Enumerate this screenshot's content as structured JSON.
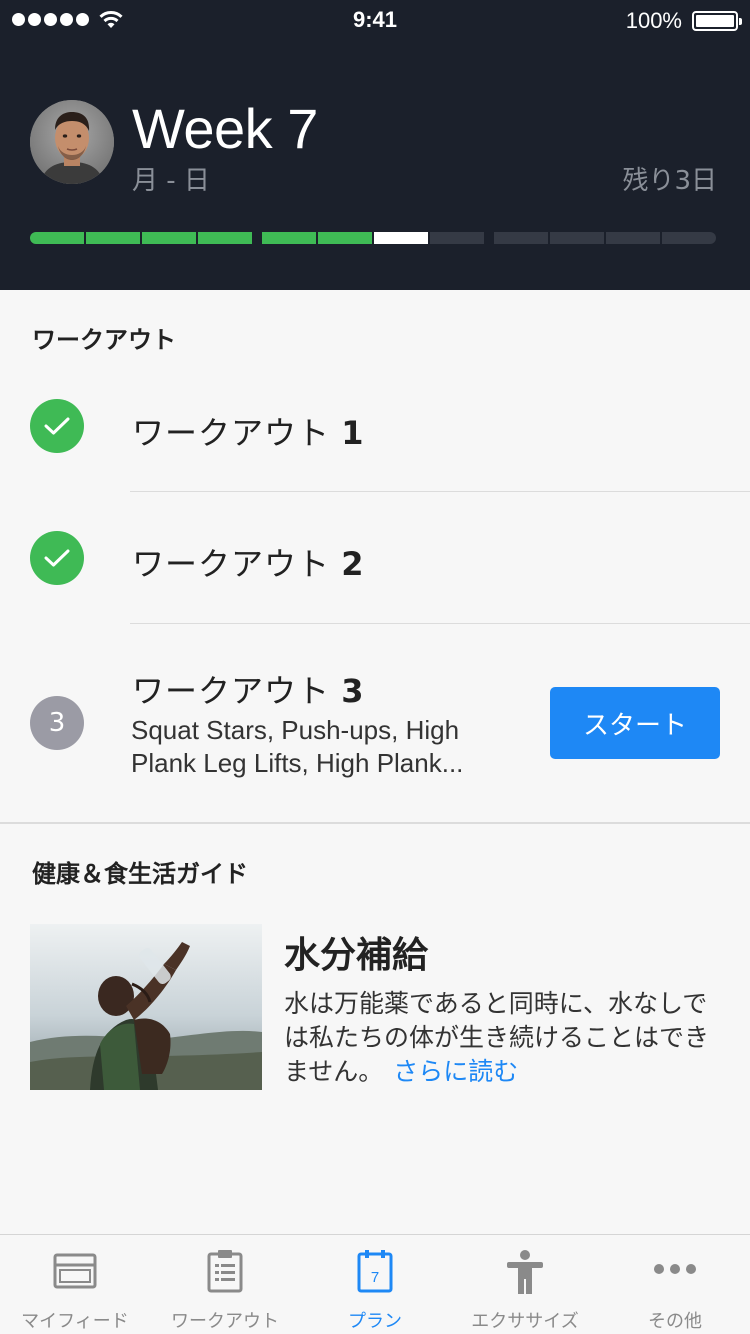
{
  "status_bar": {
    "time": "9:41",
    "battery": "100%"
  },
  "header": {
    "title": "Week 7",
    "range": "月 - 日",
    "remaining": "残り3日",
    "progress": {
      "completed": 6,
      "current": 1,
      "upcoming": 5
    }
  },
  "workouts": {
    "section_title": "ワークアウト",
    "items": [
      {
        "label": "ワークアウト ",
        "number": "1",
        "status": "done"
      },
      {
        "label": "ワークアウト ",
        "number": "2",
        "status": "done"
      },
      {
        "label": "ワークアウト ",
        "number": "3",
        "status": "pending",
        "badge": "3",
        "exercises": "Squat Stars, Push-ups, High Plank Leg Lifts, High Plank...",
        "start_label": "スタート"
      }
    ]
  },
  "guide": {
    "section_title": "健康＆食生活ガイド",
    "article_title": "水分補給",
    "article_body": "水は万能薬であると同時に、水なしでは私たちの体が生き続けることはできません。",
    "read_more": "さらに読む"
  },
  "tabbar": {
    "active": "plan",
    "tabs": [
      {
        "id": "feed",
        "label": "マイフィード",
        "icon": "feed-icon"
      },
      {
        "id": "workout",
        "label": "ワークアウト",
        "icon": "clipboard-icon"
      },
      {
        "id": "plan",
        "label": "プラン",
        "icon": "calendar-icon",
        "calendar_day": "7"
      },
      {
        "id": "exercise",
        "label": "エクササイズ",
        "icon": "person-icon"
      },
      {
        "id": "more",
        "label": "その他",
        "icon": "more-icon"
      }
    ]
  },
  "colors": {
    "header_bg": "#1b202b",
    "accent": "#1e88f5",
    "success": "#3fba55",
    "pending_badge": "#9b9ba5"
  }
}
